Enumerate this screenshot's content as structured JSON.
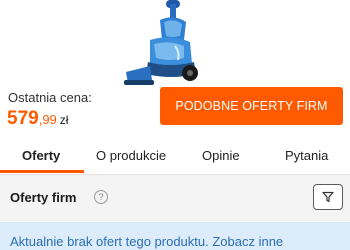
{
  "product": {
    "image_name": "carpet-cleaner-image"
  },
  "pricing": {
    "label": "Ostatnia cena:",
    "price_main": "579",
    "price_cents": ",99",
    "currency": "zł"
  },
  "cta": {
    "label": "PODOBNE OFERTY FIRM"
  },
  "tabs": [
    {
      "label": "Oferty"
    },
    {
      "label": "O produkcie"
    },
    {
      "label": "Opinie"
    },
    {
      "label": "Pytania"
    }
  ],
  "offers_section": {
    "title": "Oferty firm",
    "help_icon": "question-circle-icon",
    "filter_icon": "filter-icon"
  },
  "info_banner": {
    "text": "Aktualnie brak ofert tego produktu. Zobacz inne"
  },
  "colors": {
    "accent": "#ff5a00",
    "info_bg": "#dcecfb",
    "info_text": "#2a6fb5"
  }
}
